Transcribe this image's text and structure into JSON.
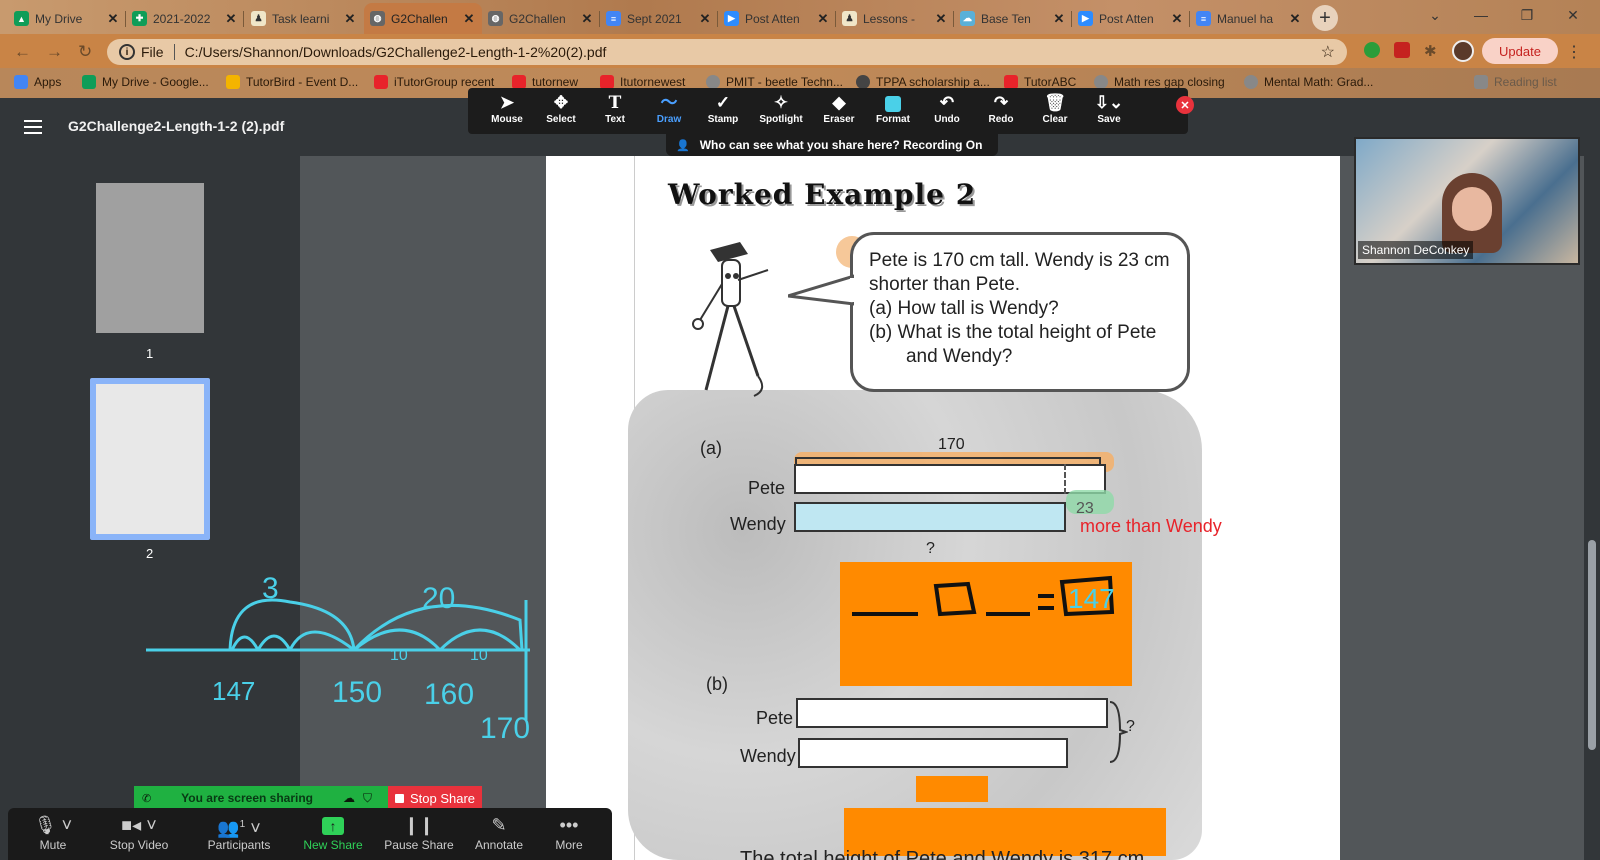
{
  "browser": {
    "tabs": [
      {
        "label": "My Drive",
        "icon": "google-drive-icon",
        "color": "#0f9d58"
      },
      {
        "label": "2021-2022",
        "icon": "google-sheets-icon",
        "color": "#0f9d58"
      },
      {
        "label": "Task learni",
        "icon": "document-icon",
        "color": "#f0e6c8"
      },
      {
        "label": "G2Challen",
        "icon": "globe-icon",
        "color": "#666666",
        "active": true
      },
      {
        "label": "G2Challen",
        "icon": "globe-icon",
        "color": "#666666"
      },
      {
        "label": "Sept 2021",
        "icon": "google-docs-icon",
        "color": "#4285f4"
      },
      {
        "label": "Post Atten",
        "icon": "zoom-icon",
        "color": "#2d8cff"
      },
      {
        "label": "Lessons -",
        "icon": "document-icon",
        "color": "#f0e6c8"
      },
      {
        "label": "Base Ten",
        "icon": "cloud-icon",
        "color": "#5ab0d8"
      },
      {
        "label": "Post Atten",
        "icon": "zoom-icon",
        "color": "#2d8cff"
      },
      {
        "label": "Manuel ha",
        "icon": "google-docs-icon",
        "color": "#4285f4"
      }
    ],
    "address": {
      "scheme": "File",
      "url": "C:/Users/Shannon/Downloads/G2Challenge2-Length-1-2%20(2).pdf"
    },
    "update_label": "Update",
    "bookmarks": [
      {
        "label": "Apps",
        "color": "#4285f4"
      },
      {
        "label": "My Drive - Google...",
        "color": "#0f9d58"
      },
      {
        "label": "TutorBird - Event D...",
        "color": "#f4b400"
      },
      {
        "label": "iTutorGroup recent",
        "color": "#e8232a"
      },
      {
        "label": "tutornew",
        "color": "#e8232a"
      },
      {
        "label": "Itutornewest",
        "color": "#e8232a"
      },
      {
        "label": "PMIT - beetle Techn...",
        "color": "#888888"
      },
      {
        "label": "TPPA scholarship a...",
        "color": "#444444"
      },
      {
        "label": "TutorABC",
        "color": "#e8232a"
      },
      {
        "label": "Math res gap closing",
        "color": "#888888"
      },
      {
        "label": "Mental Math: Grad...",
        "color": "#888888"
      },
      {
        "label": "Reading list",
        "color": "#888888"
      }
    ]
  },
  "pdf": {
    "filename": "G2Challenge2-Length-1-2 (2).pdf",
    "thumbnails": [
      {
        "num": "1"
      },
      {
        "num": "2",
        "selected": true
      }
    ]
  },
  "annotate_toolbar": {
    "tools": [
      "Mouse",
      "Select",
      "Text",
      "Draw",
      "Stamp",
      "Spotlight",
      "Eraser",
      "Format",
      "Undo",
      "Redo",
      "Clear",
      "Save"
    ],
    "selected": "Draw",
    "recording_notice": "Who can see what you share here? Recording On"
  },
  "video": {
    "name": "Shannon DeConkey"
  },
  "worksheet": {
    "title": "Worked Example 2",
    "bubble_lines": [
      "Pete is 170 cm tall. Wendy is 23 cm",
      "shorter than Pete.",
      "(a)  How tall is Wendy?",
      "(b)  What is the total height of Pete",
      "       and Wendy?"
    ],
    "part_a": "(a)",
    "part_b": "(b)",
    "pete_label": "Pete",
    "wendy_label": "Wendy",
    "value_170": "170",
    "value_23": "23",
    "question_mark": "?",
    "more_than_wendy": "more than Wendy",
    "bottom_text": "The total height of Pete and Wendy is 317 cm."
  },
  "handwriting": {
    "jump_3": "3",
    "jump_20": "20",
    "jump_10a": "10",
    "jump_10b": "10",
    "tick_147": "147",
    "tick_150": "150",
    "tick_160": "160",
    "tick_170": "170",
    "answer": "147"
  },
  "zoom": {
    "sharing_text": "You are screen sharing",
    "stop_share": "Stop Share",
    "buttons": [
      "Mute",
      "Stop Video",
      "Participants",
      "New Share",
      "Pause Share",
      "Annotate",
      "More"
    ],
    "participants_count": "1"
  }
}
